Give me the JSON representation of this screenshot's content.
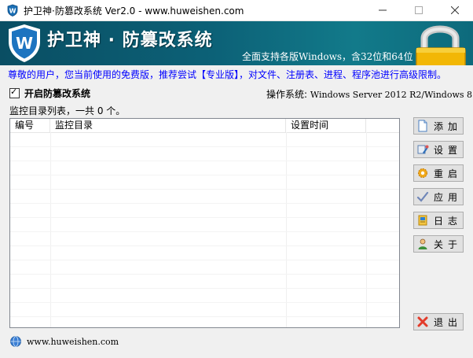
{
  "window": {
    "title": "护卫神·防篡改系统 Ver2.0 - www.huweishen.com"
  },
  "banner": {
    "title": "护卫神 · 防篡改系统",
    "subtitle": "全面支持各版Windows，含32位和64位"
  },
  "promo": "尊敬的用户，您当前使用的免费版，推荐尝试【专业版】，对文件、注册表、进程、程序池进行高级限制。",
  "enable_protection": {
    "label": "开启防篡改系统",
    "checked": true
  },
  "os": {
    "label": "操作系统:",
    "value": "Windows Server 2012 R2/Windows 8"
  },
  "list": {
    "summary": "监控目录列表，一共 0 个。",
    "columns": [
      "编号",
      "监控目录",
      "设置时间"
    ],
    "rows": []
  },
  "buttons": {
    "add": "添加",
    "settings": "设置",
    "restart": "重启",
    "apply": "应用",
    "log": "日志",
    "about": "关于",
    "exit": "退出"
  },
  "footer": {
    "url": "www.huweishen.com"
  },
  "icons": {
    "app": "shield-w-icon",
    "add": "document-icon",
    "settings": "wrench-icon",
    "restart": "gear-icon",
    "apply": "checkmark-icon",
    "log": "notebook-icon",
    "about": "person-icon",
    "exit": "red-x-icon",
    "footer": "globe-icon"
  },
  "colors": {
    "banner": "#0c6177",
    "promo_text": "#0000ff"
  }
}
